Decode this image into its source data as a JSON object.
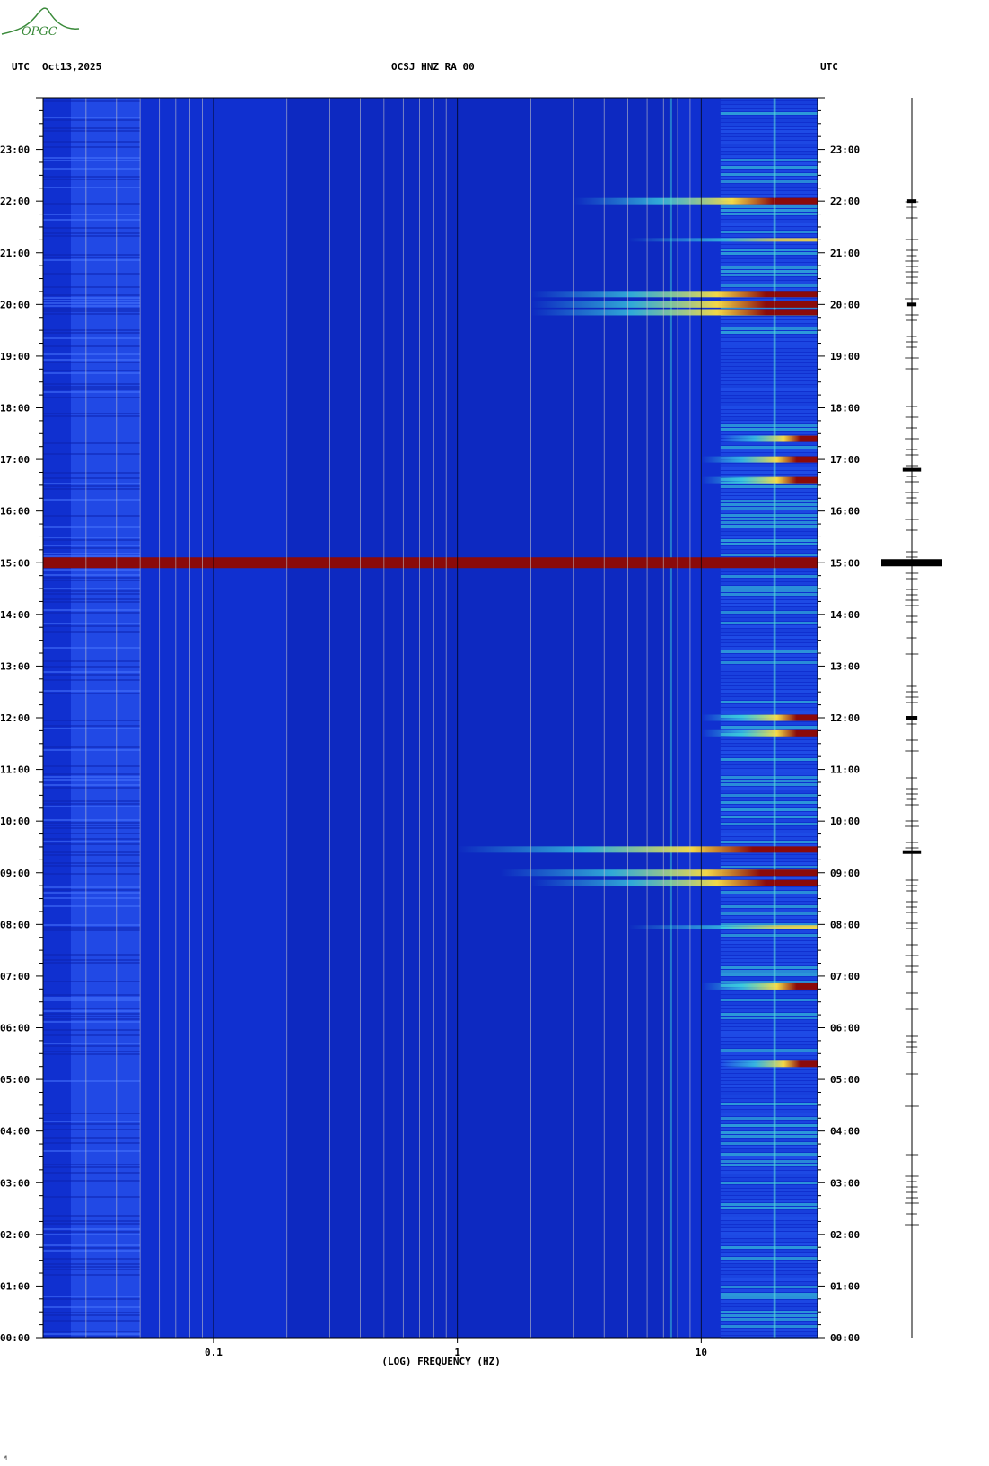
{
  "header": {
    "left_tz": "UTC",
    "date": "Oct13,2025",
    "station": "OCSJ HNZ RA 00",
    "right_tz": "UTC"
  },
  "logo": {
    "text": "OPGC",
    "color": "#3a8a3a"
  },
  "footnote": "M",
  "colors": {
    "background": "#1030d0",
    "background_dark": "#0c22b0",
    "noise_band": "#2f5ef5",
    "hot": "#8b0a0a",
    "yellow": "#ffe040",
    "cyan": "#40e0e0",
    "gridline": "#c8c8c8"
  },
  "chart_data": {
    "type": "heatmap",
    "title": "OCSJ HNZ RA 00",
    "xlabel": "(LOG) FREQUENCY (HZ)",
    "x_scale": "log",
    "xlim": [
      0.02,
      30
    ],
    "x_ticks": [
      {
        "value": 0.1,
        "label": "0.1"
      },
      {
        "value": 1,
        "label": "1"
      },
      {
        "value": 10,
        "label": "10"
      }
    ],
    "ylim_hours": [
      0,
      24
    ],
    "y_ticks": [
      "00:00",
      "01:00",
      "02:00",
      "03:00",
      "04:00",
      "05:00",
      "06:00",
      "07:00",
      "08:00",
      "09:00",
      "10:00",
      "11:00",
      "12:00",
      "13:00",
      "14:00",
      "15:00",
      "16:00",
      "17:00",
      "18:00",
      "19:00",
      "20:00",
      "21:00",
      "22:00",
      "23:00"
    ],
    "persistent_lines_hz": [
      7.5,
      20
    ],
    "events": [
      {
        "hour": 15.0,
        "fmin": 0.02,
        "fmax": 30,
        "level": "saturated"
      },
      {
        "hour": 22.0,
        "fmin": 3,
        "fmax": 30,
        "level": "high"
      },
      {
        "hour": 20.2,
        "fmin": 2,
        "fmax": 30,
        "level": "high"
      },
      {
        "hour": 20.0,
        "fmin": 2,
        "fmax": 30,
        "level": "high"
      },
      {
        "hour": 19.85,
        "fmin": 2,
        "fmax": 30,
        "level": "high"
      },
      {
        "hour": 21.25,
        "fmin": 5,
        "fmax": 30,
        "level": "medium"
      },
      {
        "hour": 9.45,
        "fmin": 1,
        "fmax": 30,
        "level": "high"
      },
      {
        "hour": 9.0,
        "fmin": 1.5,
        "fmax": 30,
        "level": "high"
      },
      {
        "hour": 8.8,
        "fmin": 2,
        "fmax": 30,
        "level": "high"
      },
      {
        "hour": 7.95,
        "fmin": 5,
        "fmax": 30,
        "level": "medium"
      },
      {
        "hour": 12.0,
        "fmin": 10,
        "fmax": 30,
        "level": "high"
      },
      {
        "hour": 11.7,
        "fmin": 10,
        "fmax": 30,
        "level": "high"
      },
      {
        "hour": 6.8,
        "fmin": 10,
        "fmax": 30,
        "level": "high"
      },
      {
        "hour": 5.3,
        "fmin": 12,
        "fmax": 30,
        "level": "high"
      },
      {
        "hour": 17.0,
        "fmin": 10,
        "fmax": 30,
        "level": "high"
      },
      {
        "hour": 16.6,
        "fmin": 10,
        "fmax": 30,
        "level": "high"
      },
      {
        "hour": 17.4,
        "fmin": 12,
        "fmax": 30,
        "level": "high"
      }
    ],
    "waveform_panel": {
      "spikes": [
        {
          "hour": 15.0,
          "amplitude": 1.0
        },
        {
          "hour": 9.4,
          "amplitude": 0.3
        },
        {
          "hour": 22.0,
          "amplitude": 0.15
        },
        {
          "hour": 20.0,
          "amplitude": 0.15
        },
        {
          "hour": 16.8,
          "amplitude": 0.3
        },
        {
          "hour": 12.0,
          "amplitude": 0.18
        }
      ]
    }
  }
}
